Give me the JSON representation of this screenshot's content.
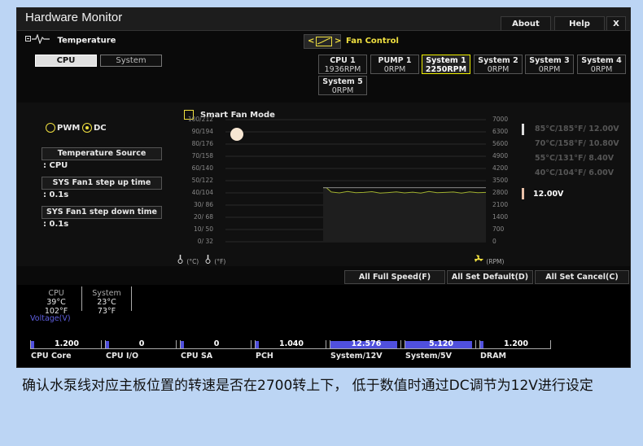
{
  "window": {
    "title": "Hardware Monitor",
    "about": "About",
    "help": "Help",
    "close": "X"
  },
  "header": {
    "temperature": "Temperature",
    "fan_control": "Fan Control",
    "nav_left": "<",
    "nav_right": ">"
  },
  "tabs": [
    {
      "label": "CPU",
      "active": true
    },
    {
      "label": "System",
      "active": false
    }
  ],
  "fans": [
    {
      "name": "CPU 1",
      "rpm": "1936RPM",
      "selected": false
    },
    {
      "name": "PUMP 1",
      "rpm": "0RPM",
      "selected": false
    },
    {
      "name": "System 1",
      "rpm": "2250RPM",
      "selected": true
    },
    {
      "name": "System 2",
      "rpm": "0RPM",
      "selected": false
    },
    {
      "name": "System 3",
      "rpm": "0RPM",
      "selected": false
    },
    {
      "name": "System 4",
      "rpm": "0RPM",
      "selected": false
    },
    {
      "name": "System 5",
      "rpm": "0RPM",
      "selected": false
    }
  ],
  "mode": {
    "pwm": "PWM",
    "dc": "DC",
    "selected": "DC"
  },
  "settings": [
    {
      "label": "Temperature Source",
      "value": ": CPU"
    },
    {
      "label": "SYS Fan1 step up time",
      "value": ": 0.1s"
    },
    {
      "label": "SYS Fan1 step down time",
      "value": ": 0.1s"
    }
  ],
  "smart_fan_mode": "Smart Fan Mode",
  "chart_data": {
    "type": "line",
    "left_ticks": [
      "100/212",
      "90/194",
      "80/176",
      "70/158",
      "60/140",
      "50/122",
      "40/104",
      "30/ 86",
      "20/ 68",
      "10/ 50",
      "0/ 32"
    ],
    "right_ticks": [
      "7000",
      "6300",
      "5600",
      "4900",
      "4200",
      "3500",
      "2800",
      "2100",
      "1400",
      "700",
      "0"
    ],
    "ylim": [
      0,
      7000
    ],
    "unit_celsius": "(°C)",
    "unit_fahrenheit": "(°F)",
    "unit_rpm": "(RPM)",
    "voltage_steps": [
      "85°C/185°F/ 12.00V",
      "70°C/158°F/ 10.80V",
      "55°C/131°F/  8.40V",
      "40°C/104°F/  6.00V"
    ],
    "current_voltage": "12.00V",
    "series": [
      {
        "x": [
          0,
          2,
          5,
          10,
          15,
          20,
          25,
          30,
          35,
          40,
          45,
          50,
          55,
          60,
          65,
          70,
          75,
          80,
          85,
          90,
          95,
          100
        ],
        "values": [
          3100,
          3100,
          2850,
          2800,
          2880,
          2810,
          2830,
          2870,
          2790,
          2820,
          2860,
          2800,
          2840,
          2790,
          2880,
          2810,
          2830,
          2850,
          2790,
          2860,
          2810,
          2830
        ]
      }
    ],
    "grid": true,
    "colors": {
      "line": "#a0b030",
      "fill": "#1e1e1e"
    }
  },
  "actions": {
    "full_speed": "All Full Speed(F)",
    "set_default": "All Set Default(D)",
    "set_cancel": "All Set Cancel(C)"
  },
  "readings": {
    "cpu": {
      "label": "CPU",
      "c": "39°C",
      "f": "102°F"
    },
    "system": {
      "label": "System",
      "c": "23°C",
      "f": "73°F"
    }
  },
  "voltage_title": "Voltage(V)",
  "voltages": [
    {
      "name": "CPU Core",
      "value": "1.200",
      "fill": 0.05
    },
    {
      "name": "CPU I/O",
      "value": "0",
      "fill": 0
    },
    {
      "name": "CPU SA",
      "value": "0",
      "fill": 0
    },
    {
      "name": "PCH",
      "value": "1.040",
      "fill": 0.05
    },
    {
      "name": "System/12V",
      "value": "12.576",
      "fill": 0.95
    },
    {
      "name": "System/5V",
      "value": "5.120",
      "fill": 0.95
    },
    {
      "name": "DRAM",
      "value": "1.200",
      "fill": 0.05
    }
  ],
  "caption": "确认水泵线对应主板位置的转速是否在2700转上下， 低于数值时通过DC调节为12V进行设定"
}
